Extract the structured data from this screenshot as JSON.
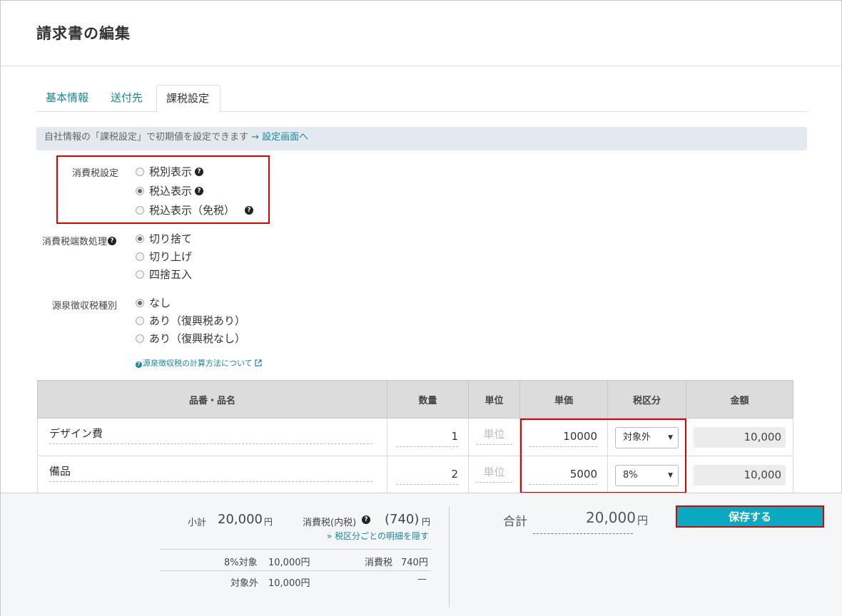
{
  "page": {
    "title": "請求書の編集"
  },
  "tabs": [
    {
      "label": "基本情報"
    },
    {
      "label": "送付先"
    },
    {
      "label": "課税設定"
    }
  ],
  "notice": {
    "text": "自社情報の「課税設定」で初期値を設定できます",
    "link": "→ 設定画面へ"
  },
  "tax_setting": {
    "label": "消費税設定",
    "options": [
      "税別表示",
      "税込表示",
      "税込表示（免税）"
    ],
    "selected": "税込表示"
  },
  "rounding": {
    "label": "消費税端数処理",
    "options": [
      "切り捨て",
      "切り上げ",
      "四捨五入"
    ],
    "selected": "切り捨て"
  },
  "withholding": {
    "label": "源泉徴収税種別",
    "options": [
      "なし",
      "あり（復興税あり）",
      "あり（復興税なし）"
    ],
    "selected": "なし",
    "help_link": "源泉徴収税の計算方法について"
  },
  "table": {
    "headers": [
      "品番・品名",
      "数量",
      "単位",
      "単価",
      "税区分",
      "金額"
    ],
    "rows": [
      {
        "name": "デザイン費",
        "qty": "1",
        "unit": "単位",
        "price": "10000",
        "tax": "対象外",
        "amount": "10,000"
      },
      {
        "name": "備品",
        "qty": "2",
        "unit": "単位",
        "price": "5000",
        "tax": "8%",
        "amount": "10,000"
      }
    ]
  },
  "summary": {
    "subtotal_label": "小計",
    "subtotal_value": "20,000",
    "yen": "円",
    "tax_label": "消費税(内税)",
    "tax_value": "(740)",
    "toggle_detail": "税区分ごとの明細を隠す",
    "breakdown": [
      {
        "label": "8%対象",
        "value": "10,000円",
        "tax_label": "消費税",
        "tax_value": "740円"
      },
      {
        "label": "対象外",
        "value": "10,000円",
        "tax_label": "",
        "tax_value": "—"
      }
    ],
    "total_label": "合計",
    "total_value": "20,000",
    "save_label": "保存する"
  },
  "colors": {
    "accent": "#17889b",
    "button": "#0aa9bf",
    "highlight": "#e00000"
  }
}
